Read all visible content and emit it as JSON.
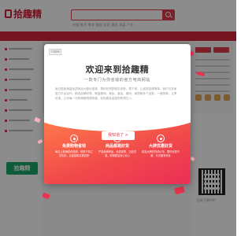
{
  "header": {
    "logo_text": "拾趣精",
    "search_placeholder": "",
    "hotwords": "衣服 鞋子 零食 数码 家居 美妆 母婴 户外"
  },
  "sidebar": {
    "row_count": 9
  },
  "app_badge": {
    "label": "拾趣精"
  },
  "modal": {
    "logo_text": "拾趣精",
    "title": "欢迎来到拾趣精",
    "subtitle": "一款专门为你省钱的官方电商网站",
    "description": "每日更新海量优质商品大额优惠券，帮你在购物前先领券，再下单，让省钱变得简单。我们与多家官方平台合作，精选品牌好物，覆盖服饰、美妆、食品、数码、家居等多个品类。一键领券，立享优惠，让你每一次购物都物超所值，轻松做会省钱的购物达人。",
    "features": [
      {
        "icon": "gift-icon",
        "title": "免费购物省钱",
        "desc": "每日上新海量优惠券，领券下单立享折扣，比直接购买更划算"
      },
      {
        "icon": "check-icon",
        "title": "商品都是好货",
        "desc": "严选品牌商品，品质保障，正品货源，购物更加放心安心"
      },
      {
        "icon": "star-icon",
        "title": "大牌优惠好货",
        "desc": "精选大牌好货低价抢，限时优惠不断，天天都有惊喜"
      }
    ],
    "cta_label": "我知道了 >"
  },
  "qr": {
    "caption": "扫码下载APP"
  },
  "colors": {
    "brand": "#e23c4e",
    "gradient_start": "#ff7a4a",
    "gradient_end": "#ec2e57"
  }
}
